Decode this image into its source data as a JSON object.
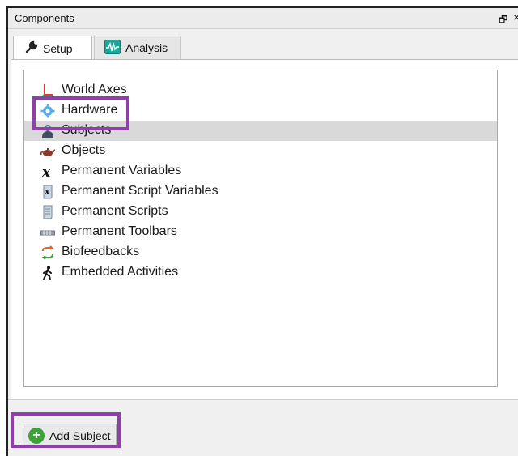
{
  "window": {
    "title": "Components",
    "float_glyph": "🗗",
    "close_glyph": "×"
  },
  "tabs": [
    {
      "label": "Setup",
      "icon": "wrench-icon",
      "active": true
    },
    {
      "label": "Analysis",
      "icon": "waveform-icon",
      "active": false
    }
  ],
  "tree": {
    "selected_index": 2,
    "items": [
      {
        "label": "World Axes",
        "icon": "axes-icon"
      },
      {
        "label": "Hardware",
        "icon": "gear-icon"
      },
      {
        "label": "Subjects",
        "icon": "person-icon"
      },
      {
        "label": "Objects",
        "icon": "teapot-icon"
      },
      {
        "label": "Permanent Variables",
        "icon": "variable-x-icon"
      },
      {
        "label": "Permanent Script Variables",
        "icon": "script-variable-icon"
      },
      {
        "label": "Permanent Scripts",
        "icon": "script-icon"
      },
      {
        "label": "Permanent Toolbars",
        "icon": "toolbar-icon"
      },
      {
        "label": "Biofeedbacks",
        "icon": "biofeedback-icon"
      },
      {
        "label": "Embedded Activities",
        "icon": "walking-person-icon"
      }
    ]
  },
  "footer": {
    "add_button_label": "Add Subject",
    "plus_glyph": "+"
  },
  "colors": {
    "highlight": "#8e3fa8",
    "selection": "#d9d9d9",
    "add_icon": "#3fa13a"
  }
}
